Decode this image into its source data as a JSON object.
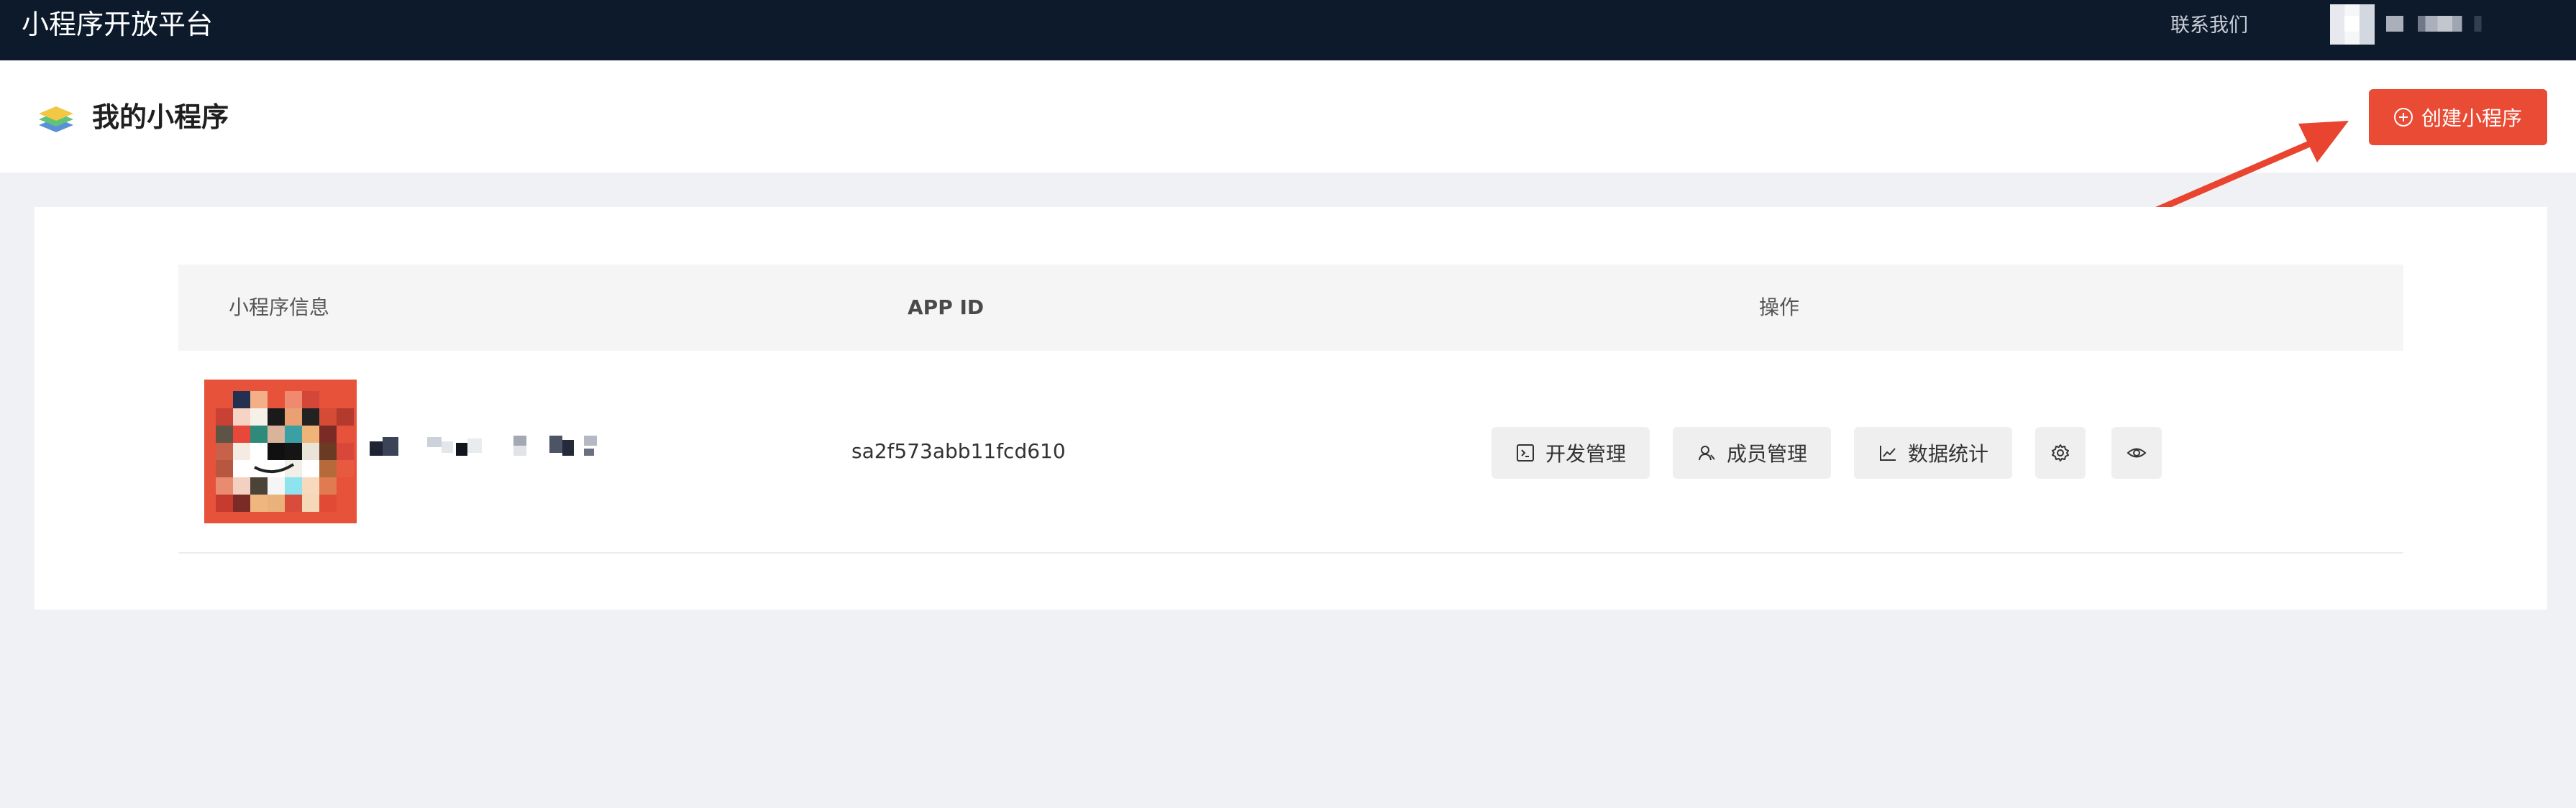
{
  "topbar": {
    "brand": "小程序开放平台",
    "contact": "联系我们"
  },
  "header": {
    "title": "我的小程序",
    "create_button": "创建小程序"
  },
  "table": {
    "columns": [
      "小程序信息",
      "APP ID",
      "操作"
    ],
    "rows": [
      {
        "app_id": "sa2f573abb11fcd610",
        "actions": [
          "开发管理",
          "成员管理",
          "数据统计"
        ]
      }
    ]
  },
  "icons": {
    "dev": "terminal-icon",
    "member": "user-icon",
    "stats": "chart-line-icon",
    "settings": "gear-icon",
    "view": "eye-icon",
    "create": "plus-circle-icon"
  },
  "colors": {
    "topbar": "#0c1a2c",
    "accent": "#e94b35",
    "page_bg": "#f0f1f4"
  }
}
